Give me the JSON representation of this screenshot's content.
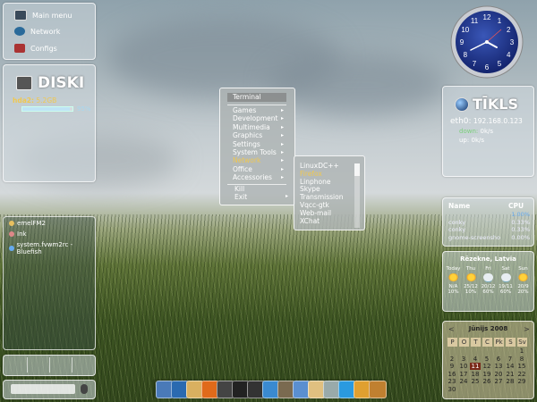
{
  "main_menu": {
    "items": [
      "Main menu",
      "Network",
      "Configs"
    ]
  },
  "disk": {
    "title": "DISKI",
    "device": "hda2:",
    "size": "5.2GB",
    "percent": "95%",
    "usage_fraction": 0.95
  },
  "net": {
    "title": "TĪKLS",
    "interface": "eth0:",
    "ip": "192.168.0.123",
    "down_label": "down:",
    "down_value": "0k/s",
    "up_label": "up:",
    "up_value": "0k/s"
  },
  "taskbar": {
    "items": [
      "emelFM2",
      "Ink",
      "system.fvwm2rc - Bluefish"
    ]
  },
  "clock": {
    "numbers": [
      "12",
      "1",
      "2",
      "3",
      "4",
      "5",
      "6",
      "7",
      "8",
      "9",
      "10",
      "11"
    ]
  },
  "menu": {
    "title": "Terminal",
    "items": [
      {
        "label": "Games",
        "has_sub": true,
        "active": false
      },
      {
        "label": "Development",
        "has_sub": true,
        "active": false
      },
      {
        "label": "Multimedia",
        "has_sub": true,
        "active": false
      },
      {
        "label": "Graphics",
        "has_sub": true,
        "active": false
      },
      {
        "label": "Settings",
        "has_sub": true,
        "active": false
      },
      {
        "label": "System Tools",
        "has_sub": true,
        "active": false
      },
      {
        "label": "Network",
        "has_sub": true,
        "active": true
      },
      {
        "label": "Office",
        "has_sub": true,
        "active": false
      },
      {
        "label": "Accessories",
        "has_sub": true,
        "active": false
      }
    ],
    "footer": [
      "Kill",
      "Exit"
    ]
  },
  "submenu": {
    "items": [
      {
        "label": "LinuxDC++",
        "active": false
      },
      {
        "label": "Firefox",
        "active": true
      },
      {
        "label": "Linphone",
        "active": false
      },
      {
        "label": "Skype",
        "active": false
      },
      {
        "label": "Transmission",
        "active": false
      },
      {
        "label": "Vqcc-gtk",
        "active": false
      },
      {
        "label": "Web-mail",
        "active": false
      },
      {
        "label": "XChat",
        "active": false
      }
    ]
  },
  "cpu": {
    "headers": [
      "Name",
      "CPU"
    ],
    "rows": [
      {
        "name": "",
        "value": "1.00%"
      },
      {
        "name": "conky",
        "value": "0.33%"
      },
      {
        "name": "conky",
        "value": "0.33%"
      },
      {
        "name": "gnome-screensho",
        "value": "0.00%"
      }
    ]
  },
  "weather": {
    "location": "Rēzekne, Latvia",
    "days": [
      {
        "day": "Today",
        "temp": "N/A",
        "precip": "10%",
        "icon": "sun-icon"
      },
      {
        "day": "Thu",
        "temp": "25/12",
        "precip": "10%",
        "icon": "sun-icon"
      },
      {
        "day": "Fri",
        "temp": "20/12",
        "precip": "60%",
        "icon": "cloud-rain-icon"
      },
      {
        "day": "Sat",
        "temp": "19/11",
        "precip": "60%",
        "icon": "cloud-rain-icon"
      },
      {
        "day": "Sun",
        "temp": "20/9",
        "precip": "20%",
        "icon": "sun-icon"
      }
    ]
  },
  "calendar": {
    "month": "Jūnijs 2008",
    "prev": "<",
    "next": ">",
    "weekdays": [
      "P",
      "O",
      "T",
      "C",
      "Pk",
      "S",
      "Sv"
    ],
    "rows": [
      [
        "",
        "",
        "",
        "",
        "",
        "",
        "1"
      ],
      [
        "2",
        "3",
        "4",
        "5",
        "6",
        "7",
        "8"
      ],
      [
        "9",
        "10",
        "11",
        "12",
        "13",
        "14",
        "15"
      ],
      [
        "16",
        "17",
        "18",
        "19",
        "20",
        "21",
        "22"
      ],
      [
        "23",
        "24",
        "25",
        "26",
        "27",
        "28",
        "29"
      ],
      [
        "30",
        "",
        "",
        "",
        "",
        "",
        ""
      ]
    ],
    "today": "11"
  },
  "colors": {
    "accent_text": "#f0c850",
    "net_green": "#7ad07a",
    "percent_blue": "#a8d8f0"
  }
}
